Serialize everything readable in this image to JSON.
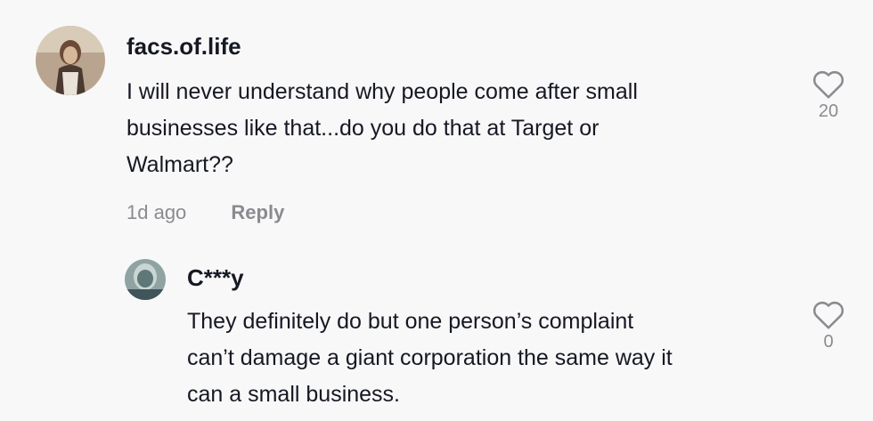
{
  "comments": [
    {
      "username": "facs.of.life",
      "text_lines": [
        "I will never understand why people come after small",
        "businesses like that...do you do that at Target or",
        "Walmart??"
      ],
      "time": "1d ago",
      "reply_label": "Reply",
      "like_count": "20",
      "like_icon": "heart-outline-icon"
    },
    {
      "username": "C***y",
      "text_lines": [
        "They definitely do but one person’s complaint",
        "can’t damage a giant corporation the same way it",
        "can a small business."
      ],
      "like_count": "0",
      "like_icon": "heart-outline-icon"
    }
  ],
  "colors": {
    "background": "#f8f8f8",
    "primary_text": "#161823",
    "secondary_text": "#8a8b91"
  }
}
